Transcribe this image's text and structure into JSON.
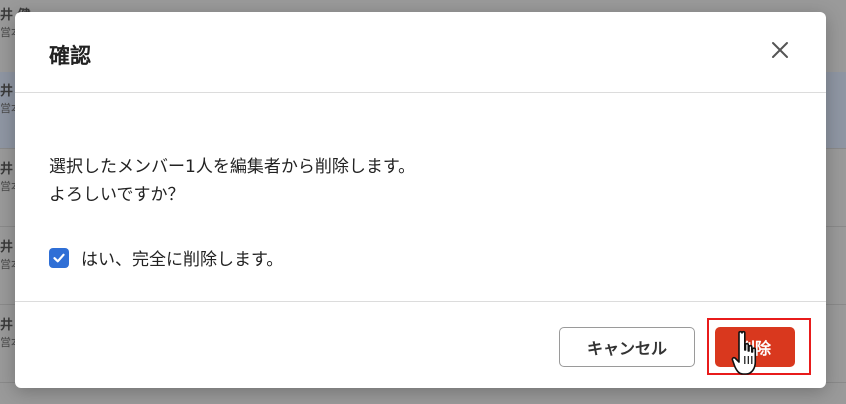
{
  "background": {
    "rows": [
      {
        "name": "井 健",
        "sub": "営本"
      },
      {
        "name": "井",
        "sub": "営本"
      },
      {
        "name": "井",
        "sub": "営本"
      },
      {
        "name": "井",
        "sub": "営本"
      },
      {
        "name": "井",
        "sub": "営本"
      }
    ]
  },
  "dialog": {
    "title": "確認",
    "close_icon": "close-icon",
    "message_line1": "選択したメンバー1人を編集者から削除します。",
    "message_line2": "よろしいですか？",
    "checkbox_label": "はい、完全に削除します。",
    "checkbox_checked": true,
    "cancel_label": "キャンセル",
    "delete_label": "削除"
  },
  "colors": {
    "delete_button": "#d9381e",
    "checkbox": "#2f6fd6",
    "highlight_box": "#e81b1b"
  }
}
